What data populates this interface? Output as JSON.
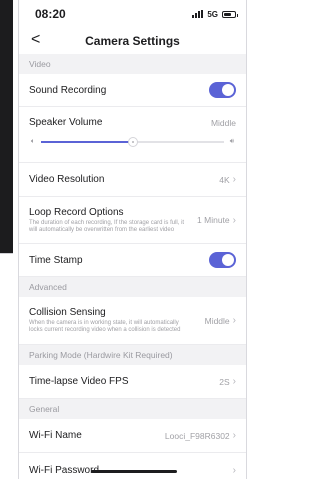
{
  "status": {
    "time": "08:20",
    "network": "5G"
  },
  "nav": {
    "back": "<",
    "title": "Camera Settings"
  },
  "sections": {
    "video": "Video",
    "advanced": "Advanced",
    "parking": "Parking Mode (Hardwire Kit Required)",
    "general": "General"
  },
  "rows": {
    "sound_recording": {
      "label": "Sound Recording",
      "enabled": true
    },
    "speaker_volume": {
      "label": "Speaker Volume",
      "value": "Middle",
      "level_fraction": 0.5
    },
    "video_resolution": {
      "label": "Video Resolution",
      "value": "4K"
    },
    "loop_record": {
      "label": "Loop Record Options",
      "desc": "The duration of each recording, If the storage card is full, it will automatically be overwritten from the earliest video",
      "value": "1 Minute"
    },
    "time_stamp": {
      "label": "Time Stamp",
      "enabled": true
    },
    "collision": {
      "label": "Collision Sensing",
      "desc": "When the camera is in working state, it will automatically locks current recording video when a collision is detected",
      "value": "Middle"
    },
    "timelapse": {
      "label": "Time-lapse Video FPS",
      "value": "2S"
    },
    "wifi_name": {
      "label": "Wi-Fi Name",
      "value": "Looci_F98R6302"
    },
    "wifi_password": {
      "label": "Wi-Fi Password"
    }
  },
  "icons": {
    "volume_low": "speaker-low-icon",
    "volume_high": "speaker-high-icon",
    "chevron": "chevron-right-icon"
  },
  "colors": {
    "accent": "#5b63d6",
    "section_bg": "#f2f2f4"
  }
}
